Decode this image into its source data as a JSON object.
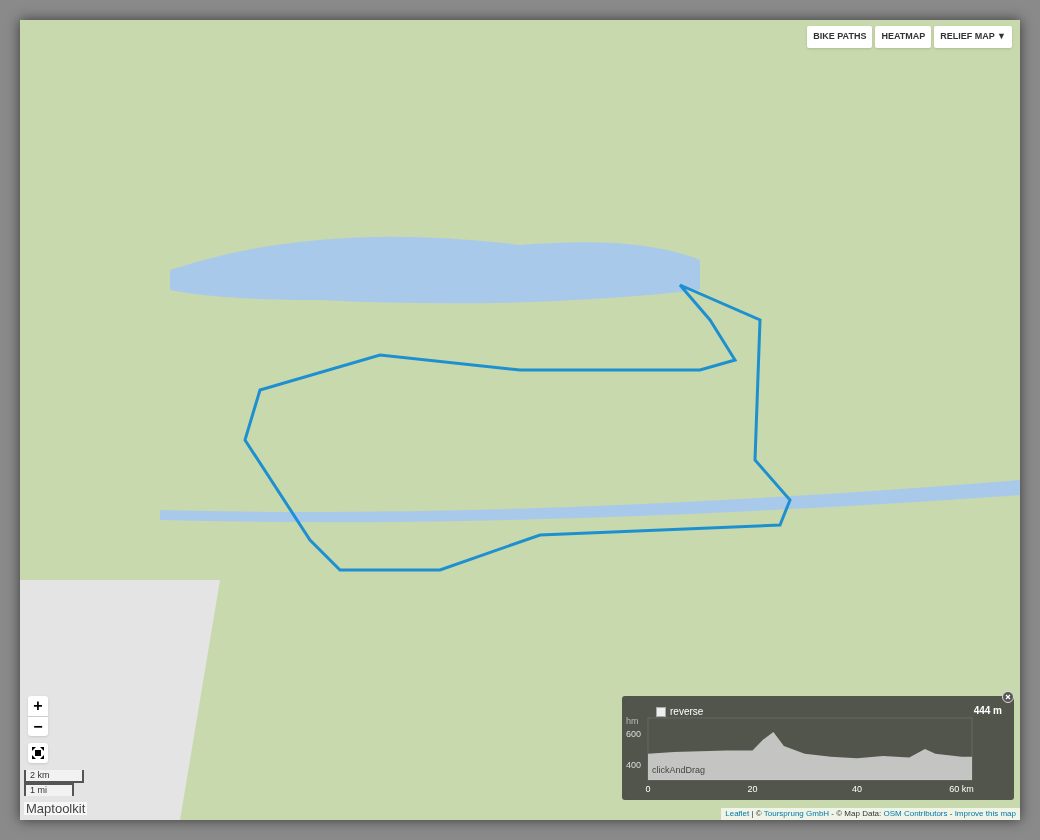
{
  "map_controls": {
    "layer_buttons": [
      {
        "label": "BIKE PATHS"
      },
      {
        "label": "HEATMAP"
      },
      {
        "label": "RELIEF MAP ▼"
      }
    ],
    "zoom_in": "+",
    "zoom_out": "−",
    "scale": {
      "metric": "2 km",
      "imperial": "1 mi"
    },
    "logo": "Maptoolkit"
  },
  "elevation": {
    "reverse": {
      "label": "reverse",
      "checked": false
    },
    "current": "444 m",
    "drag_hint": "clickAndDrag",
    "chart_data": {
      "type": "area",
      "ylabel": "hm",
      "x": [
        0,
        5,
        10,
        15,
        20,
        22,
        24,
        26,
        30,
        35,
        40,
        45,
        50,
        53,
        55,
        60,
        62
      ],
      "series": [
        {
          "color": "#d8d8d8",
          "values": [
            470,
            480,
            485,
            490,
            490,
            560,
            610,
            520,
            470,
            450,
            440,
            455,
            445,
            500,
            470,
            450,
            450
          ]
        }
      ],
      "xlim": [
        0,
        62
      ],
      "ylim": [
        300,
        700
      ],
      "xticks": [
        0,
        20,
        40,
        {
          "value": 60,
          "label": "60 km"
        }
      ],
      "yticks": [
        400,
        600
      ]
    }
  },
  "attribution": [
    {
      "kind": "link",
      "text": "Leaflet"
    },
    {
      "kind": "text",
      "text": " | © "
    },
    {
      "kind": "link",
      "text": "Toursprung GmbH"
    },
    {
      "kind": "text",
      "text": " - © Map Data: "
    },
    {
      "kind": "link",
      "text": "OSM Contributors"
    },
    {
      "kind": "text",
      "text": " - "
    },
    {
      "kind": "link",
      "text": "Improve this map"
    }
  ]
}
